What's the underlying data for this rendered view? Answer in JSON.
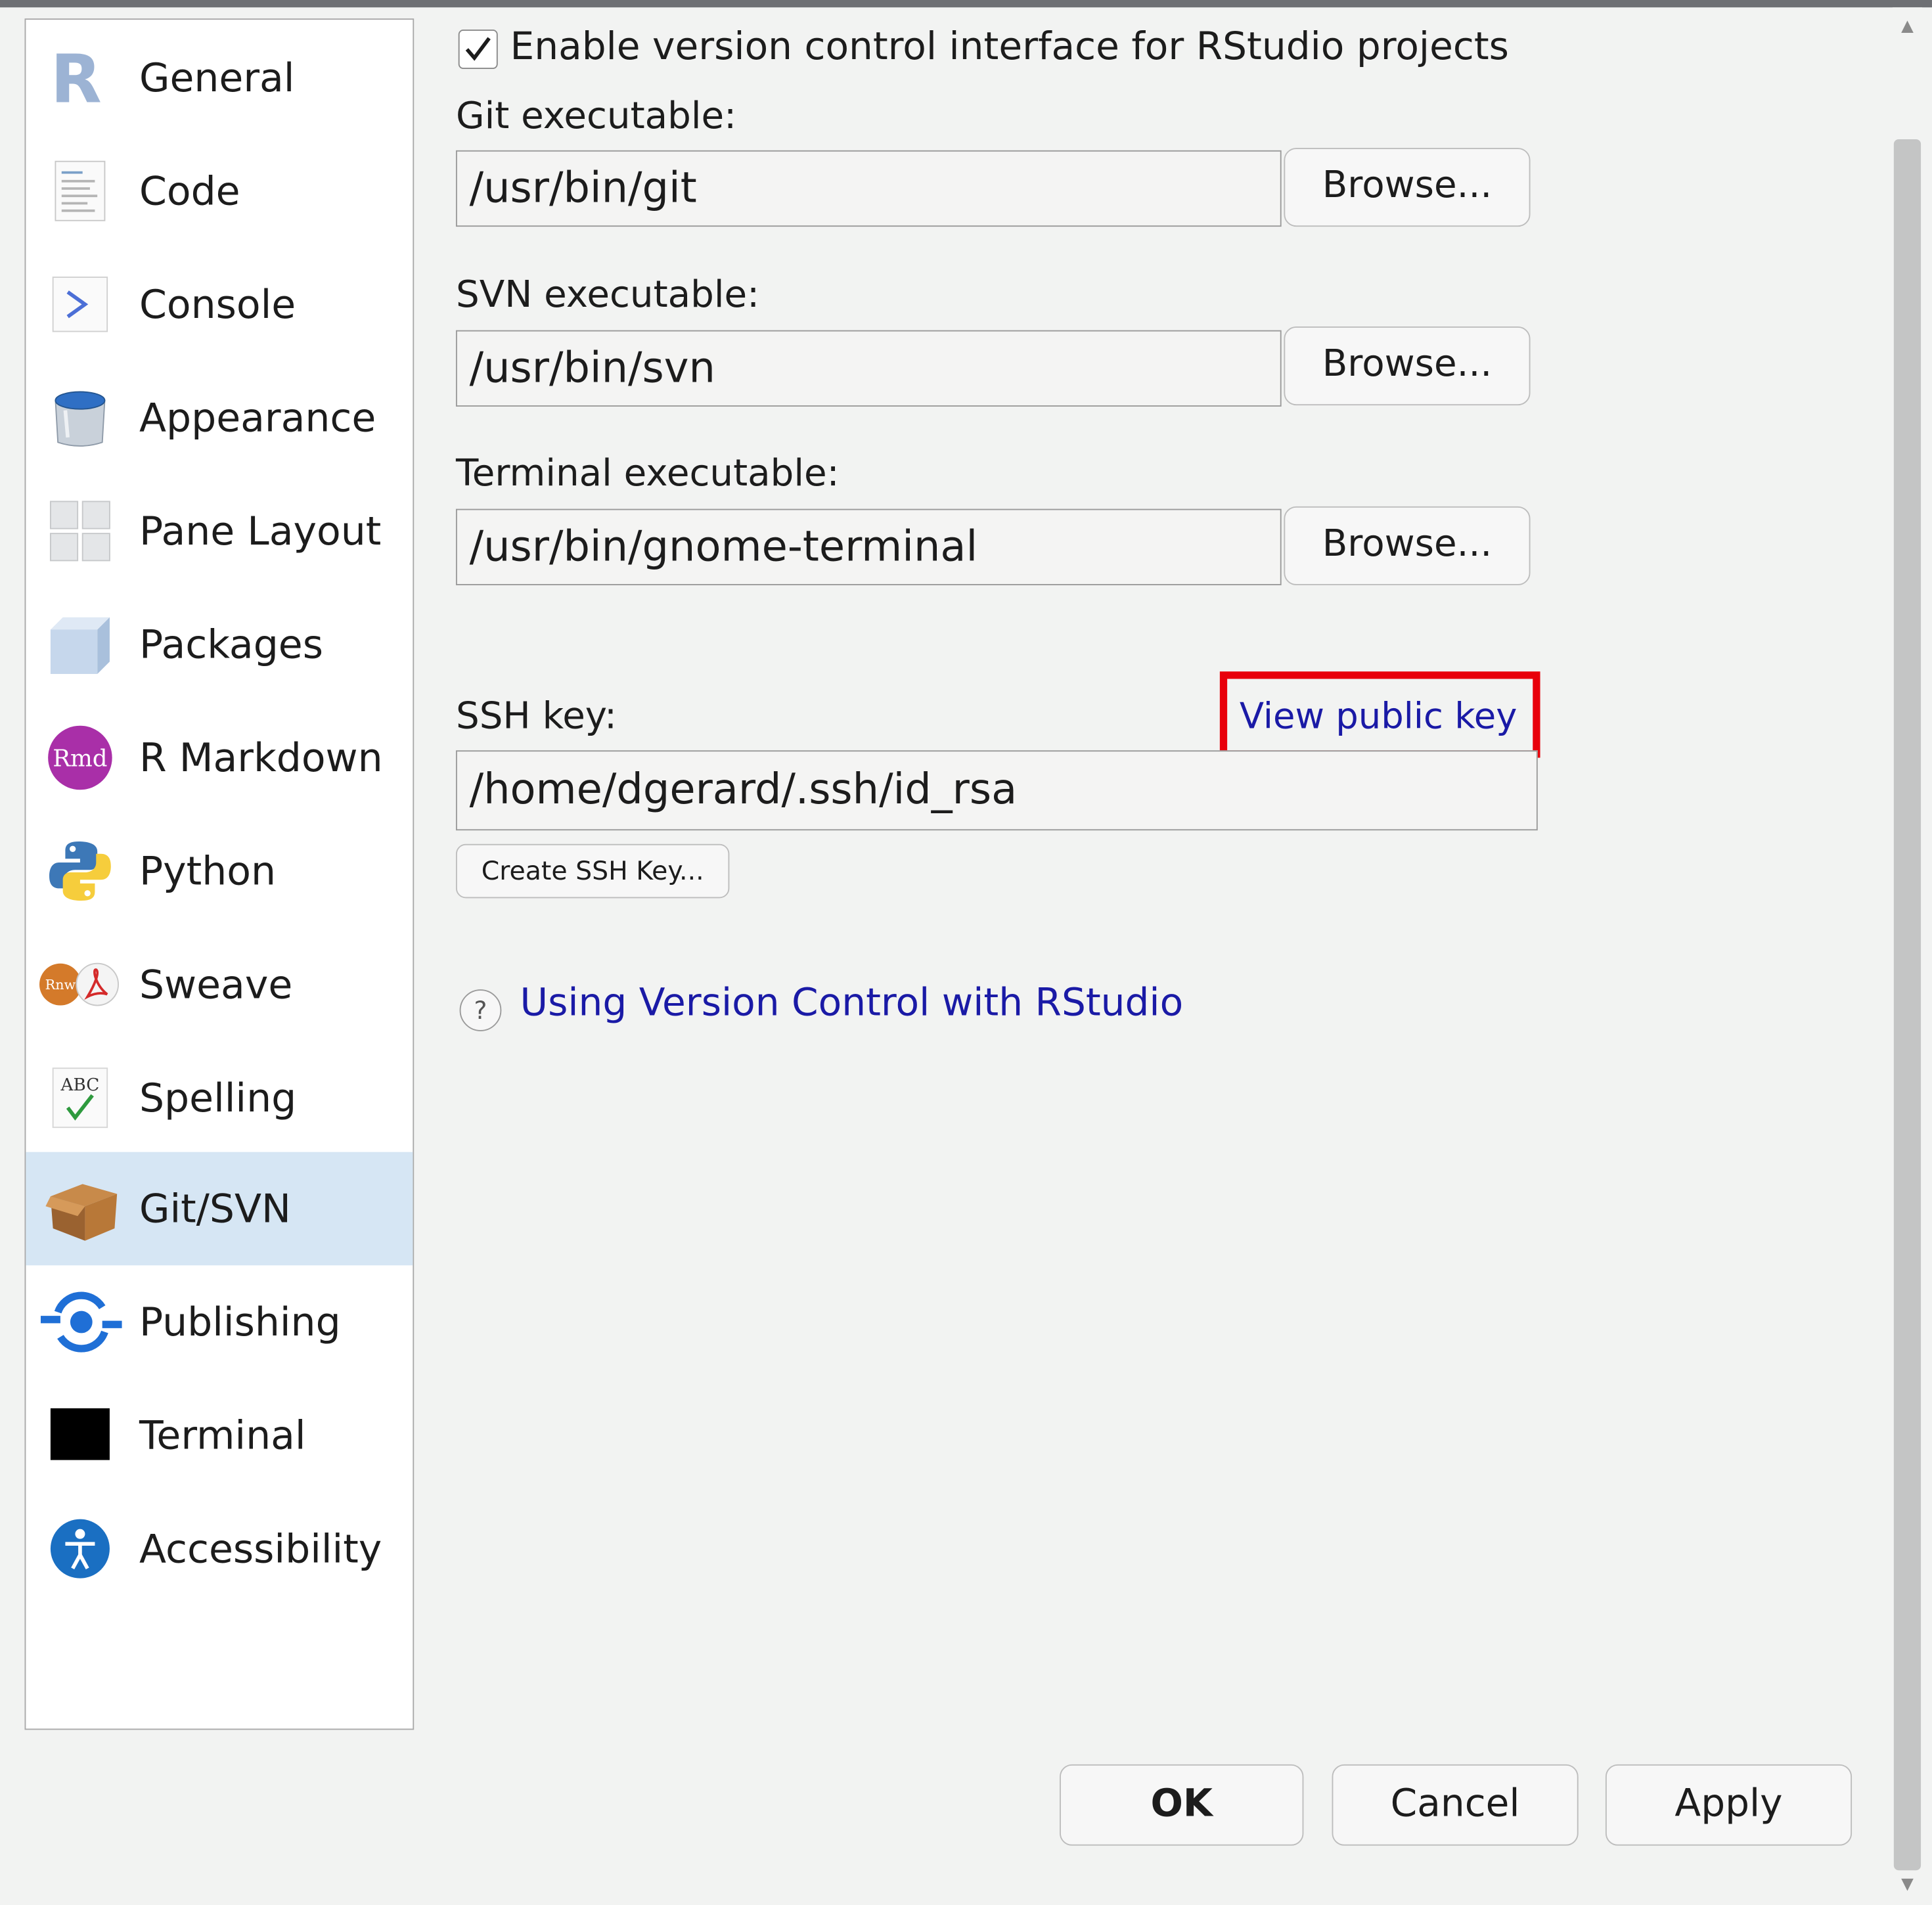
{
  "sidebar": {
    "items": [
      {
        "label": "General",
        "icon": "r-logo-icon"
      },
      {
        "label": "Code",
        "icon": "code-document-icon"
      },
      {
        "label": "Console",
        "icon": "console-prompt-icon"
      },
      {
        "label": "Appearance",
        "icon": "paint-bucket-icon"
      },
      {
        "label": "Pane Layout",
        "icon": "pane-grid-icon"
      },
      {
        "label": "Packages",
        "icon": "package-box-icon"
      },
      {
        "label": "R Markdown",
        "icon": "rmd-icon"
      },
      {
        "label": "Python",
        "icon": "python-logo-icon"
      },
      {
        "label": "Sweave",
        "icon": "sweave-pdf-icon"
      },
      {
        "label": "Spelling",
        "icon": "spelling-abc-icon"
      },
      {
        "label": "Git/SVN",
        "icon": "git-box-icon"
      },
      {
        "label": "Publishing",
        "icon": "publishing-icon"
      },
      {
        "label": "Terminal",
        "icon": "terminal-icon"
      },
      {
        "label": "Accessibility",
        "icon": "accessibility-icon"
      }
    ],
    "selected": "Git/SVN"
  },
  "main": {
    "enable_vcs": {
      "label": "Enable version control interface for RStudio projects",
      "checked": true
    },
    "git": {
      "label": "Git executable:",
      "value": "/usr/bin/git",
      "browse": "Browse..."
    },
    "svn": {
      "label": "SVN executable:",
      "value": "/usr/bin/svn",
      "browse": "Browse..."
    },
    "terminal": {
      "label": "Terminal executable:",
      "value": "/usr/bin/gnome-terminal",
      "browse": "Browse..."
    },
    "ssh": {
      "label": "SSH key:",
      "view_public_key": "View public key",
      "value": "/home/dgerard/.ssh/id_rsa",
      "create": "Create SSH Key..."
    },
    "help_link": "Using Version Control with RStudio",
    "help_icon": "?"
  },
  "footer": {
    "ok": "OK",
    "cancel": "Cancel",
    "apply": "Apply"
  },
  "colors": {
    "selection": "#d6e6f4",
    "link": "#1a1aa6",
    "highlight_box": "#e8000b"
  }
}
